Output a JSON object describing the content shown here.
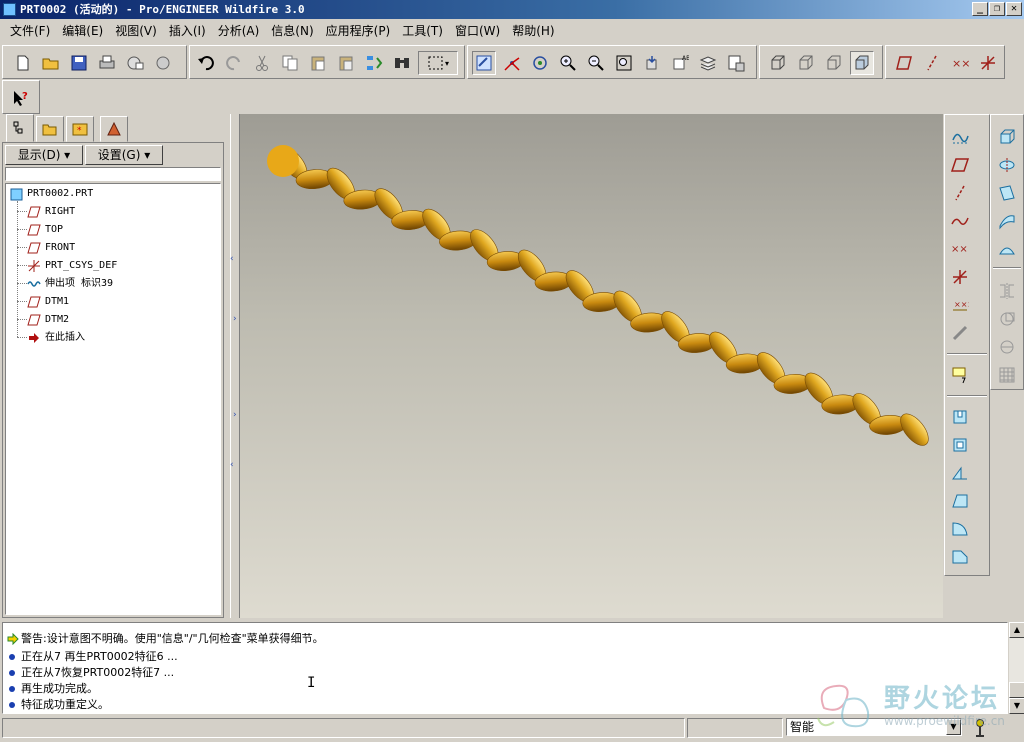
{
  "window": {
    "title": "PRT0002 (活动的) - Pro/ENGINEER Wildfire 3.0",
    "controls": [
      "_",
      "❐",
      "✕"
    ]
  },
  "menubar": [
    "文件(F)",
    "编辑(E)",
    "视图(V)",
    "插入(I)",
    "分析(A)",
    "信息(N)",
    "应用程序(P)",
    "工具(T)",
    "窗口(W)",
    "帮助(H)"
  ],
  "navigator": {
    "show_button": "显示(D) ▾",
    "settings_button": "设置(G) ▾",
    "model_tree": [
      {
        "label": "PRT0002.PRT",
        "icon": "part-icon"
      },
      {
        "label": "RIGHT",
        "icon": "datum-plane-icon"
      },
      {
        "label": "TOP",
        "icon": "datum-plane-icon"
      },
      {
        "label": "FRONT",
        "icon": "datum-plane-icon"
      },
      {
        "label": "PRT_CSYS_DEF",
        "icon": "csys-icon"
      },
      {
        "label": "伸出项 标识39",
        "icon": "protrusion-icon"
      },
      {
        "label": "DTM1",
        "icon": "datum-plane-icon"
      },
      {
        "label": "DTM2",
        "icon": "datum-plane-icon"
      },
      {
        "label": "在此插入",
        "icon": "insert-here-arrow-icon"
      }
    ]
  },
  "messages": [
    {
      "text": "警告:设计意图不明确。使用\"信息\"/\"几何检查\"菜单获得细节。",
      "type": "warning"
    },
    {
      "text": "正在从7 再生PRT0002特征6 ...",
      "type": "info"
    },
    {
      "text": "正在从7恢复PRT0002特征7 ...",
      "type": "info"
    },
    {
      "text": "再生成功完成。",
      "type": "info"
    },
    {
      "text": "特征成功重定义。",
      "type": "info"
    }
  ],
  "status": {
    "filter_value": "智能"
  },
  "watermark": {
    "title": "野火论坛",
    "url": "www.proewildfire.cn"
  },
  "colors": {
    "title_bar_start": "#0a246a",
    "model_gold": "#d9a21a",
    "message_bullet": "#1a3fb0"
  }
}
